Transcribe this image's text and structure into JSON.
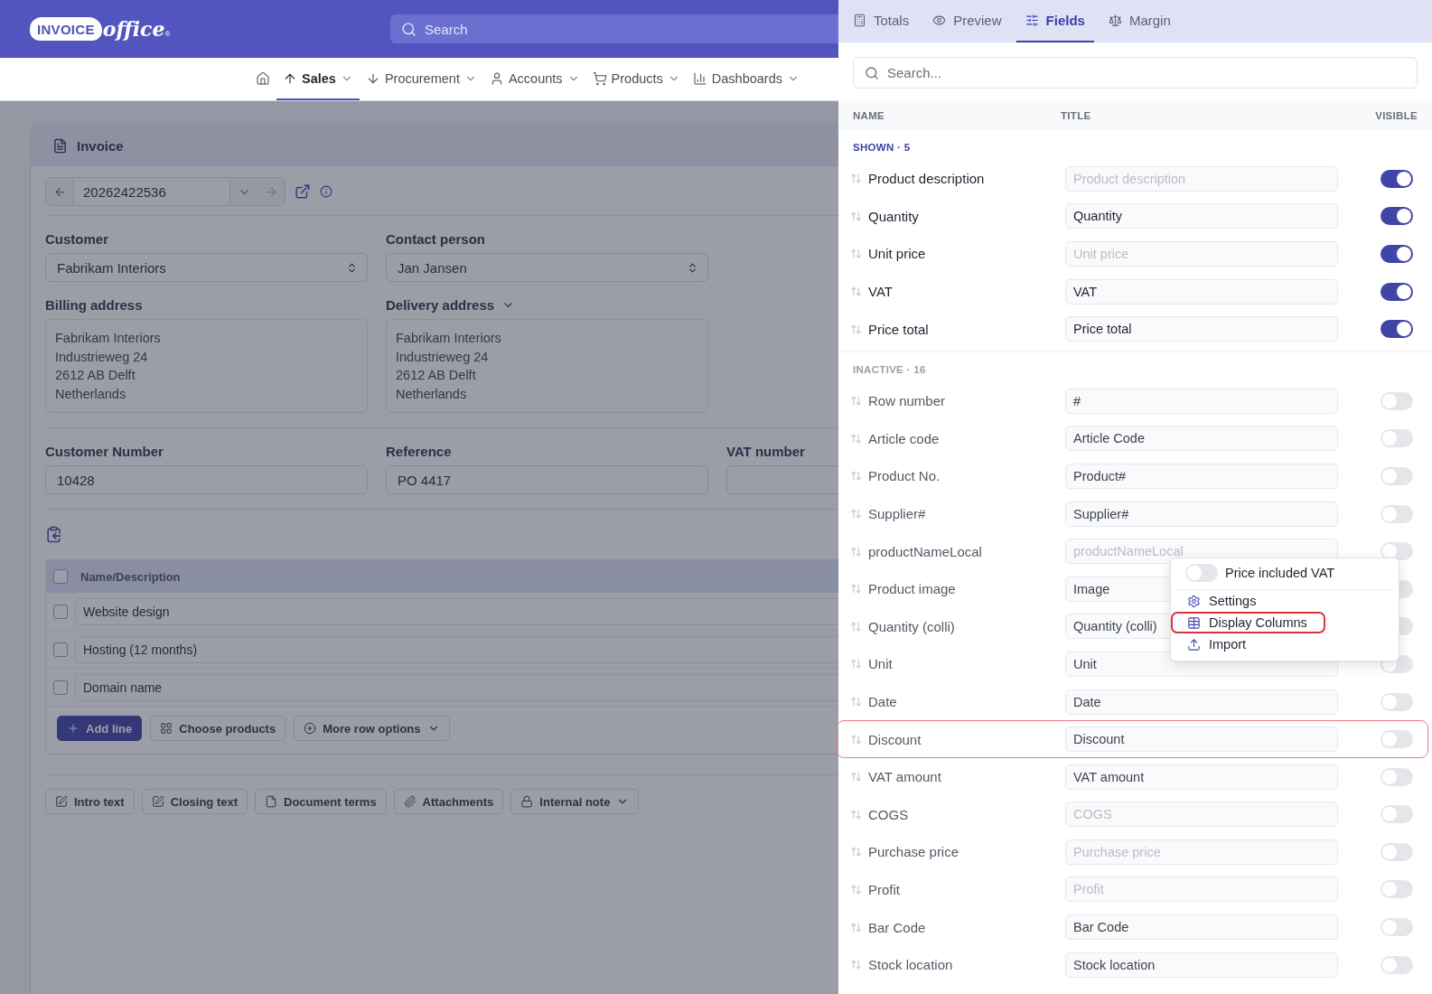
{
  "header": {
    "logo": {
      "badge": "INVOICE",
      "script": "office",
      "mark": "®"
    },
    "search": {
      "placeholder": "Search"
    }
  },
  "nav": [
    {
      "kind": "home",
      "selected": false
    },
    {
      "kind": "menu",
      "label": "Sales",
      "selected": true
    },
    {
      "kind": "menu",
      "label": "Procurement",
      "selected": false
    },
    {
      "kind": "menu",
      "label": "Accounts",
      "selected": false
    },
    {
      "kind": "menu",
      "label": "Products",
      "selected": false
    },
    {
      "kind": "menu",
      "label": "Dashboards",
      "selected": false
    }
  ],
  "invoice": {
    "title": "Invoice",
    "number": "20262422536",
    "customer": {
      "label": "Customer",
      "value": "Fabrikam Interiors"
    },
    "contact_person": {
      "label": "Contact person",
      "value": "Jan Jansen"
    },
    "billing_address": {
      "label": "Billing address",
      "lines": [
        "Fabrikam Interiors",
        "Industrieweg 24",
        "2612 AB Delft",
        "Netherlands"
      ]
    },
    "delivery_address": {
      "label": "Delivery address",
      "lines": [
        "Fabrikam Interiors",
        "Industrieweg 24",
        "2612 AB Delft",
        "Netherlands"
      ]
    },
    "customer_number": {
      "label": "Customer Number",
      "value": "10428"
    },
    "reference": {
      "label": "Reference",
      "value": "PO 4417"
    },
    "vat_number": {
      "label": "VAT number"
    },
    "lines": {
      "header": {
        "label": "Name/Description",
        "checked": false
      },
      "rows": [
        {
          "name": "Website design",
          "checked": false
        },
        {
          "name": "Hosting (12 months)",
          "checked": false
        },
        {
          "name": "Domain name",
          "checked": false
        }
      ]
    },
    "row_actions": [
      {
        "kind": "primary",
        "label": "Add line"
      },
      {
        "kind": "choose",
        "label": "Choose products"
      },
      {
        "kind": "more",
        "label": "More row options"
      }
    ],
    "footer_buttons": [
      {
        "kind": "intro",
        "label": "Intro text"
      },
      {
        "kind": "closing",
        "label": "Closing text"
      },
      {
        "kind": "terms",
        "label": "Document terms"
      },
      {
        "kind": "attach",
        "label": "Attachments"
      },
      {
        "kind": "note",
        "label": "Internal note"
      }
    ]
  },
  "panel": {
    "tabs": [
      {
        "kind": "totals",
        "label": "Totals",
        "selected": false
      },
      {
        "kind": "preview",
        "label": "Preview",
        "selected": false
      },
      {
        "kind": "fields",
        "label": "Fields",
        "selected": true
      },
      {
        "kind": "margin",
        "label": "Margin",
        "selected": false
      }
    ],
    "search": {
      "placeholder": "Search..."
    },
    "columns": [
      "NAME",
      "TITLE",
      "VISIBLE"
    ],
    "sections": [
      {
        "kind": "shown",
        "heading": "SHOWN · 5",
        "fields": [
          {
            "name": "Product description",
            "placeholder": "Product description",
            "visible": true
          },
          {
            "name": "Quantity",
            "value": "Quantity",
            "visible": true
          },
          {
            "name": "Unit price",
            "placeholder": "Unit price",
            "visible": true
          },
          {
            "name": "VAT",
            "value": "VAT",
            "visible": true
          },
          {
            "name": "Price total",
            "value": "Price total",
            "visible": true
          }
        ]
      },
      {
        "kind": "inactive",
        "heading": "INACTIVE · 16",
        "fields": [
          {
            "name": "Row number",
            "value": "#",
            "visible": false
          },
          {
            "name": "Article code",
            "value": "Article Code",
            "visible": false
          },
          {
            "name": "Product No.",
            "value": "Product#",
            "visible": false
          },
          {
            "name": "Supplier#",
            "value": "Supplier#",
            "visible": false
          },
          {
            "name": "productNameLocal",
            "placeholder": "productNameLocal",
            "visible": false
          },
          {
            "name": "Product image",
            "value": "Image",
            "visible": false
          },
          {
            "name": "Quantity (colli)",
            "value": "Quantity (colli)",
            "visible": false
          },
          {
            "name": "Unit",
            "value": "Unit",
            "visible": false
          },
          {
            "name": "Date",
            "value": "Date",
            "visible": false
          },
          {
            "name": "Discount",
            "value": "Discount",
            "visible": false,
            "highlighted": true
          },
          {
            "name": "VAT amount",
            "value": "VAT amount",
            "visible": false
          },
          {
            "name": "COGS",
            "placeholder": "COGS",
            "visible": false
          },
          {
            "name": "Purchase price",
            "placeholder": "Purchase price",
            "visible": false
          },
          {
            "name": "Profit",
            "placeholder": "Profit",
            "visible": false
          },
          {
            "name": "Bar Code",
            "value": "Bar Code",
            "visible": false
          },
          {
            "name": "Stock location",
            "value": "Stock location",
            "visible": false
          }
        ]
      }
    ],
    "menu": {
      "toggle": {
        "label": "Price included VAT",
        "on": false
      },
      "items": [
        {
          "kind": "settings",
          "label": "Settings",
          "highlighted": false
        },
        {
          "kind": "columns",
          "label": "Display Columns",
          "highlighted": true
        },
        {
          "kind": "import",
          "label": "Import",
          "highlighted": false
        }
      ]
    }
  }
}
